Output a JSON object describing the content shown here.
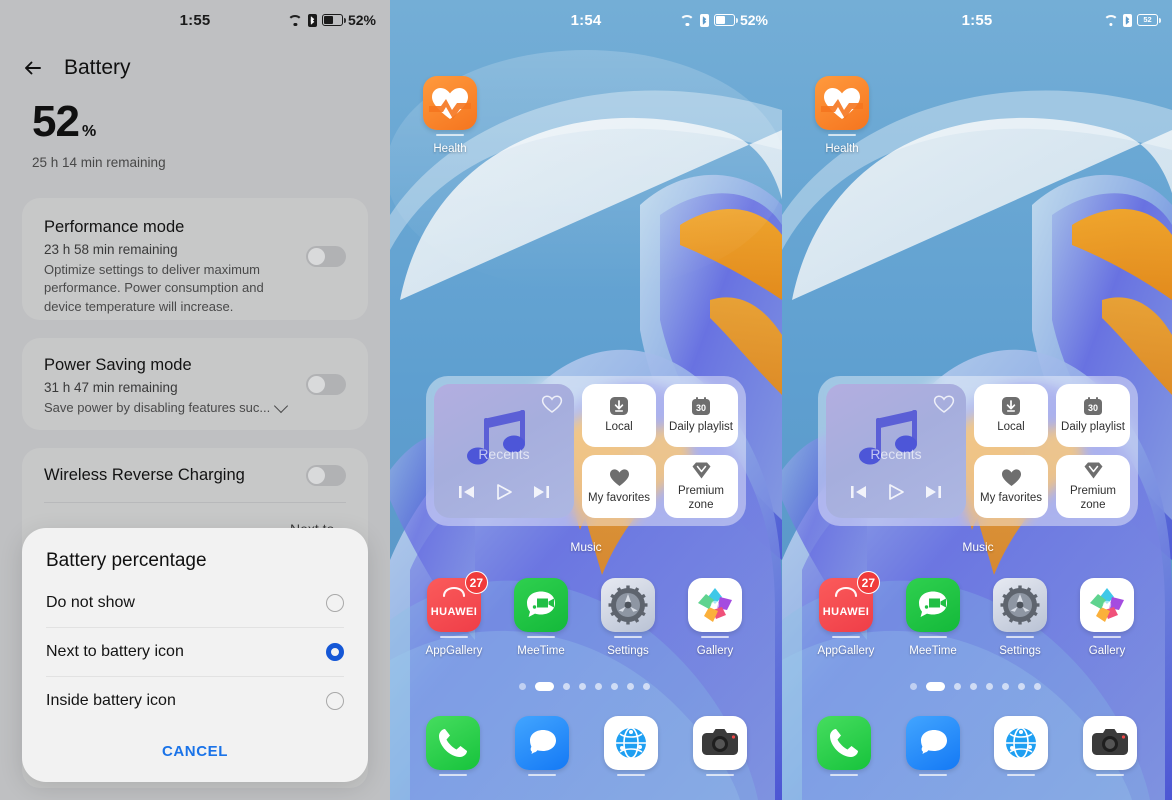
{
  "panels": {
    "left": {
      "statusbar": {
        "time": "1:55",
        "battery_percent": "52%",
        "wifi_icon": "wifi-icon",
        "bluetooth_icon": "bluetooth-icon",
        "battery_icon": "battery-icon",
        "theme": "dark"
      },
      "nav": {
        "back_icon": "back-arrow-icon",
        "title": "Battery"
      },
      "hero": {
        "value": "52",
        "unit": "%",
        "remaining": "25 h 14 min remaining"
      },
      "cards": [
        {
          "title": "Performance mode",
          "subtitle": "23 h 58 min remaining",
          "description": "Optimize settings to deliver maximum performance. Power consumption and device temperature will increase.",
          "toggle_on": false
        },
        {
          "title": "Power Saving mode",
          "subtitle": "31 h 47 min remaining",
          "description": "Save power by disabling features suc...",
          "expand_icon": "chevron-down-icon",
          "toggle_on": false
        }
      ],
      "wireless_reverse_charging": {
        "title": "Wireless Reverse Charging",
        "toggle_on": false
      },
      "battery_percentage_row": {
        "value": "Next to..."
      },
      "dialog": {
        "title": "Battery percentage",
        "options": [
          {
            "label": "Do not show",
            "selected": false
          },
          {
            "label": "Next to battery icon",
            "selected": true
          },
          {
            "label": "Inside battery icon",
            "selected": false
          }
        ],
        "cancel_label": "CANCEL",
        "accent_color": "#1a73e8",
        "selected_color": "#1557d6"
      }
    },
    "middle": {
      "statusbar": {
        "time": "1:54",
        "battery_percent": "52%",
        "wifi_icon": "wifi-icon",
        "bluetooth_icon": "bluetooth-icon",
        "battery_icon": "battery-icon",
        "percent_mode": "next-to-icon",
        "theme": "light"
      }
    },
    "right": {
      "statusbar": {
        "time": "1:55",
        "battery_percent": "52",
        "wifi_icon": "wifi-icon",
        "bluetooth_icon": "bluetooth-icon",
        "battery_icon": "battery-icon",
        "percent_mode": "inside-icon",
        "theme": "light"
      }
    }
  },
  "home": {
    "top_app": {
      "label": "Health",
      "icon": "health-icon"
    },
    "widget": {
      "label": "Music",
      "album": {
        "title": "Recents",
        "heart_icon": "heart-outline-icon",
        "note_icon": "music-note-icon",
        "prev_icon": "previous-track-icon",
        "play_icon": "play-icon",
        "next_icon": "next-track-icon"
      },
      "tiles": [
        {
          "label": "Local",
          "icon": "download-icon"
        },
        {
          "label": "Daily playlist",
          "icon": "calendar-30-icon"
        },
        {
          "label": "My favorites",
          "icon": "heart-filled-icon"
        },
        {
          "label": "Premium zone",
          "icon": "diamond-icon"
        }
      ]
    },
    "apps": [
      {
        "label": "AppGallery",
        "icon": "appgallery-icon",
        "brand_text": "HUAWEI",
        "badge": "27"
      },
      {
        "label": "MeeTime",
        "icon": "meetime-icon"
      },
      {
        "label": "Settings",
        "icon": "settings-gear-icon"
      },
      {
        "label": "Gallery",
        "icon": "gallery-icon"
      }
    ],
    "pager": {
      "pages": 8,
      "active_index": 1
    },
    "dock": [
      {
        "label": "Phone",
        "icon": "phone-icon"
      },
      {
        "label": "Messages",
        "icon": "messages-icon"
      },
      {
        "label": "Browser",
        "icon": "browser-globe-icon"
      },
      {
        "label": "Camera",
        "icon": "camera-icon"
      }
    ]
  }
}
